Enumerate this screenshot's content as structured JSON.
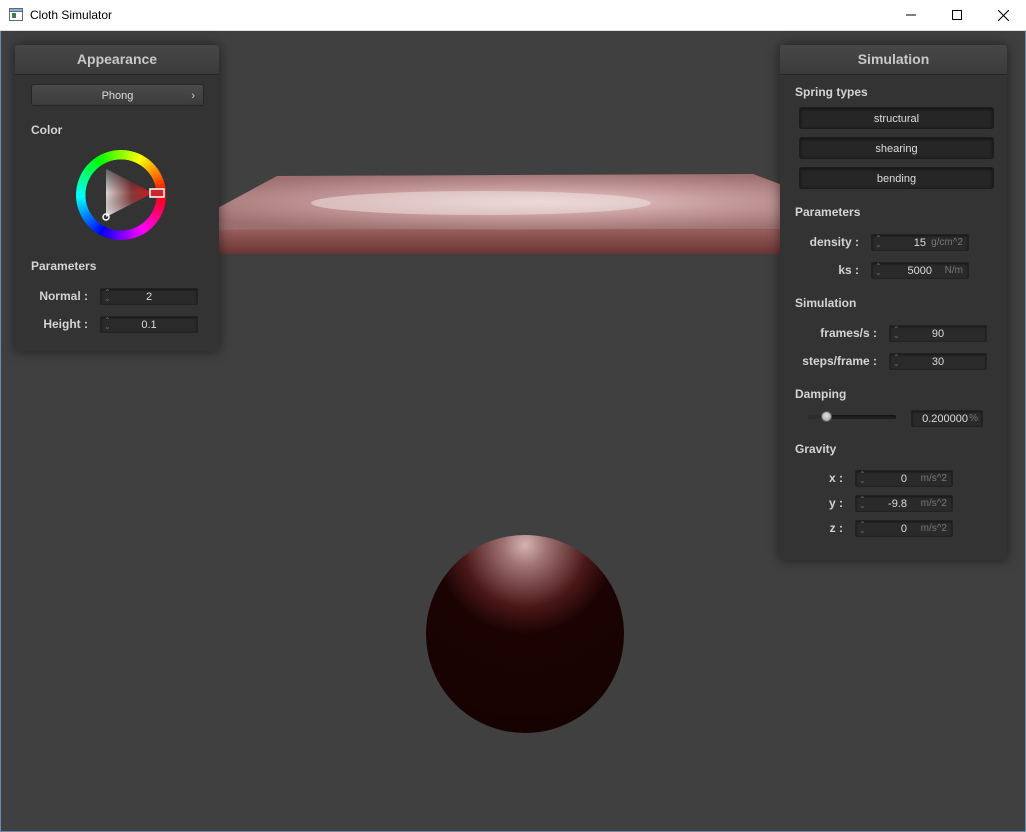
{
  "window": {
    "title": "Cloth Simulator",
    "minimize_icon": "minimize-icon",
    "maximize_icon": "maximize-icon",
    "close_icon": "close-icon"
  },
  "appearance": {
    "title": "Appearance",
    "shader": "Phong",
    "color_label": "Color",
    "params_label": "Parameters",
    "normal_label": "Normal :",
    "normal_value": "2",
    "height_label": "Height :",
    "height_value": "0.1",
    "selected_color": "#c8262a"
  },
  "simulation": {
    "title": "Simulation",
    "spring_types_label": "Spring types",
    "springs": [
      "structural",
      "shearing",
      "bending"
    ],
    "parameters_label": "Parameters",
    "density_label": "density :",
    "density_value": "15",
    "density_unit": "g/cm^2",
    "ks_label": "ks :",
    "ks_value": "5000",
    "ks_unit": "N/m",
    "simulation_label": "Simulation",
    "fps_label": "frames/s :",
    "fps_value": "90",
    "steps_label": "steps/frame :",
    "steps_value": "30",
    "damping_label": "Damping",
    "damping_value": "0.200000",
    "damping_unit": "%",
    "damping_level": 0.2,
    "gravity_label": "Gravity",
    "gx_label": "x :",
    "gx_value": "0",
    "gy_label": "y :",
    "gy_value": "-9.8",
    "gz_label": "z :",
    "gz_value": "0",
    "gravity_unit": "m/s^2"
  },
  "scene": {
    "cloth_color": "#cfa8a8",
    "sphere_color": "#1a0404"
  }
}
